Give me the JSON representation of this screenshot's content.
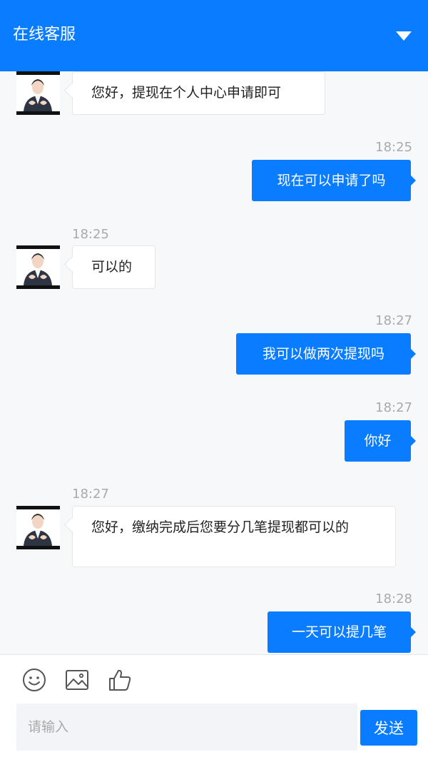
{
  "header": {
    "title": "在线客服",
    "toggle_icon": "triangle-down-icon",
    "bg_color": "#0a7cff"
  },
  "messages": [
    {
      "from": "agent",
      "time": "",
      "text": "您好，提现在个人中心申请即可"
    },
    {
      "from": "user",
      "time": "18:25",
      "text": "现在可以申请了吗"
    },
    {
      "from": "agent",
      "time": "18:25",
      "text": "可以的"
    },
    {
      "from": "user",
      "time": "18:27",
      "text": "我可以做两次提现吗"
    },
    {
      "from": "user",
      "time": "18:27",
      "text": "你好"
    },
    {
      "from": "agent",
      "time": "18:27",
      "text": "您好，缴纳完成后您要分几笔提现都可以的"
    },
    {
      "from": "user",
      "time": "18:28",
      "text": "一天可以提几笔"
    }
  ],
  "toolbar": {
    "icons": [
      "smiley-icon",
      "image-icon",
      "thumbs-up-icon"
    ],
    "input_placeholder": "请输入",
    "input_value": "",
    "send_label": "发送"
  }
}
